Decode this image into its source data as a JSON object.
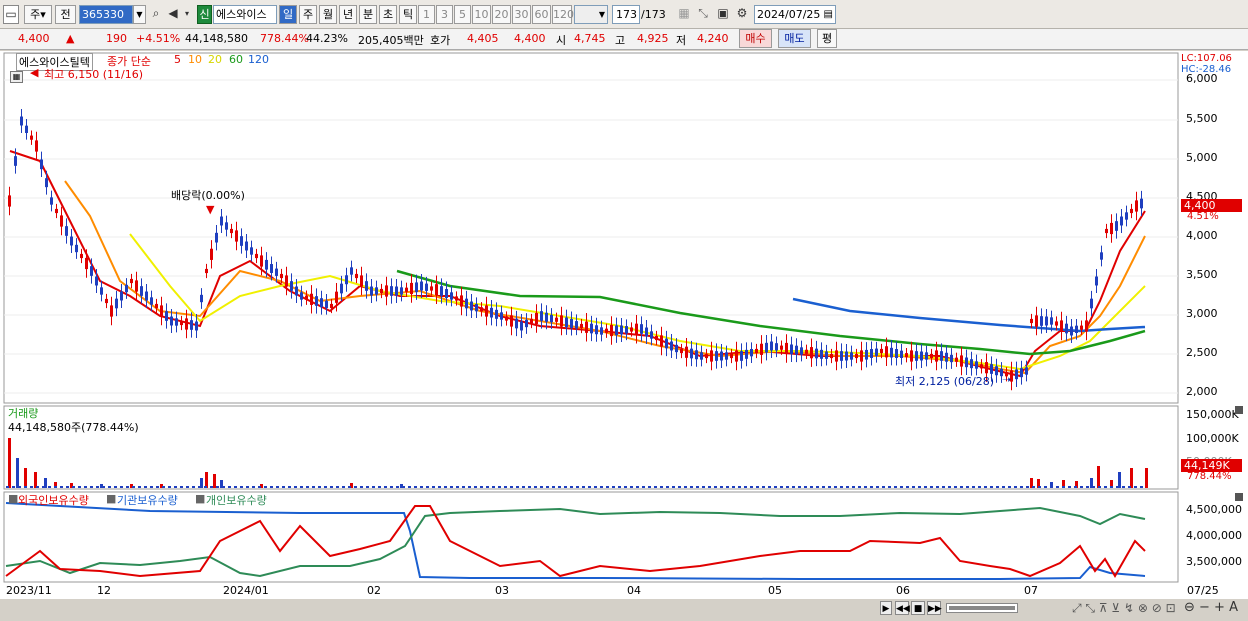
{
  "toolbar": {
    "market": "주",
    "prev": "전",
    "code": "365330",
    "new_badge": "신",
    "name": "에스와이스",
    "periods": [
      "일",
      "주",
      "월",
      "년",
      "분",
      "초",
      "틱"
    ],
    "minutes": [
      "1",
      "3",
      "5",
      "10",
      "20",
      "30",
      "60",
      "120"
    ],
    "count": "173",
    "total": "/173",
    "date": "2024/07/25"
  },
  "quote": {
    "price": "4,400",
    "arrow": "▲",
    "change": "190",
    "rate": "+4.51%",
    "volume": "44,148,580",
    "vol_ratio": "778.44%",
    "turnover": "44.23%",
    "amount": "205,405백만",
    "hoga_label": "호가",
    "hoga1": "4,405",
    "hoga2": "4,400",
    "open_label": "시",
    "open": "4,745",
    "high_label": "고",
    "high": "4,925",
    "low_label": "저",
    "low": "4,240",
    "buy": "매수",
    "sell": "매도",
    "avg": "평"
  },
  "price_panel": {
    "stock_tag": "에스와이스틸텍",
    "ma_title": "종가 단순",
    "ma_periods": [
      "5",
      "10",
      "20",
      "60",
      "120"
    ],
    "ma_colors": [
      "#e00000",
      "#ff8c00",
      "#e8e800",
      "#1a9a1a",
      "#1a5fd0"
    ],
    "high_note": "최고 6,150 (11/16)",
    "dividend_note": "배당락(0.00%)",
    "low_note": "최저 2,125 (06/28)",
    "lc": "LC:107.06",
    "hc": "HC:-28.46",
    "y_ticks": [
      "6,000",
      "5,500",
      "5,000",
      "4,500",
      "4,000",
      "3,500",
      "3,000",
      "2,500",
      "2,000"
    ],
    "last_price": "4,400",
    "last_rate": "4.51%"
  },
  "volume_panel": {
    "title": "거래량",
    "note": "44,148,580주(778.44%)",
    "y_ticks": [
      "150,000K",
      "100,000K",
      "50,000K"
    ],
    "last": "44,149K",
    "last_rate": "778.44%"
  },
  "holding_panel": {
    "legend": [
      "외국인보유수량",
      "기관보유수량",
      "개인보유수량"
    ],
    "colors": [
      "#e00000",
      "#1a5fd0",
      "#2e8b57"
    ],
    "y_ticks": [
      "4,500,000",
      "4,000,000",
      "3,500,000"
    ]
  },
  "x_axis": {
    "labels": [
      "2023/11",
      "12",
      "2024/01",
      "02",
      "03",
      "04",
      "05",
      "06",
      "07"
    ],
    "right_label": "07/25"
  },
  "colors": {
    "up": "#e00000",
    "down": "#1f3fbf",
    "bg": "#ffffff",
    "frame": "#d4d0c8"
  }
}
